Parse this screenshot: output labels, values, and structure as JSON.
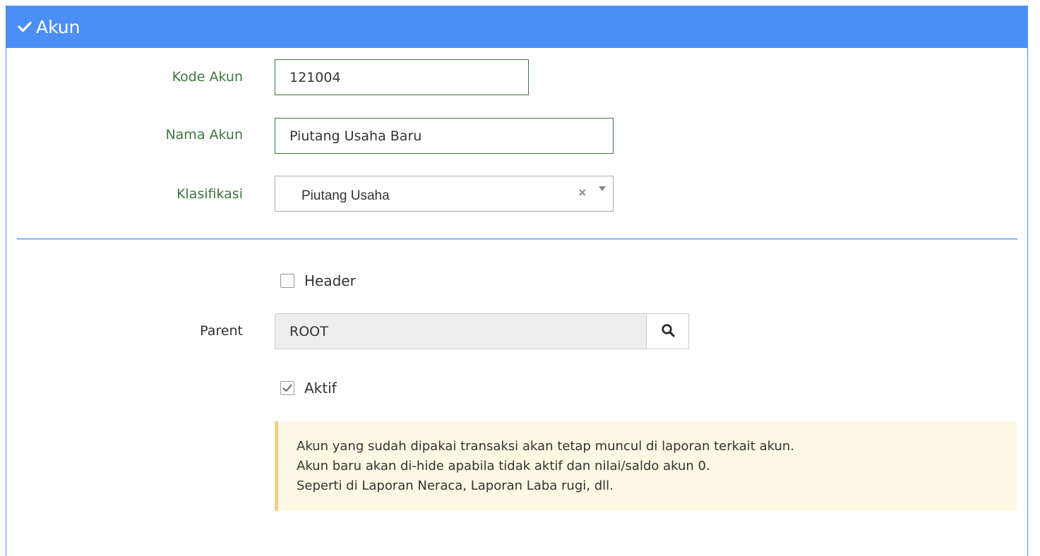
{
  "panel": {
    "title": "Akun"
  },
  "form": {
    "kode_akun": {
      "label": "Kode Akun",
      "value": "121004"
    },
    "nama_akun": {
      "label": "Nama Akun",
      "value": "Piutang Usaha Baru"
    },
    "klasifikasi": {
      "label": "Klasifikasi",
      "selected": "Piutang Usaha",
      "clear_symbol": "×"
    },
    "header_checkbox": {
      "label": "Header",
      "checked": false
    },
    "parent": {
      "label": "Parent",
      "value": "ROOT"
    },
    "aktif_checkbox": {
      "label": "Aktif",
      "checked": true
    }
  },
  "alert": {
    "lines": [
      "Akun yang sudah dipakai transaksi akan tetap muncul di laporan terkait akun.",
      "Akun baru akan di-hide apabila tidak aktif dan nilai/saldo akun 0.",
      "Seperti di Laporan Neraca, Laporan Laba rugi, dll."
    ]
  },
  "colors": {
    "header_bg": "#4b8ef5",
    "label_green": "#3c763d",
    "alert_bg": "#fcf8e3",
    "alert_border": "#f0d08a"
  },
  "icons": {
    "header": "check-icon",
    "parent_lookup": "search-icon",
    "aktif_check": "checkmark-icon"
  }
}
